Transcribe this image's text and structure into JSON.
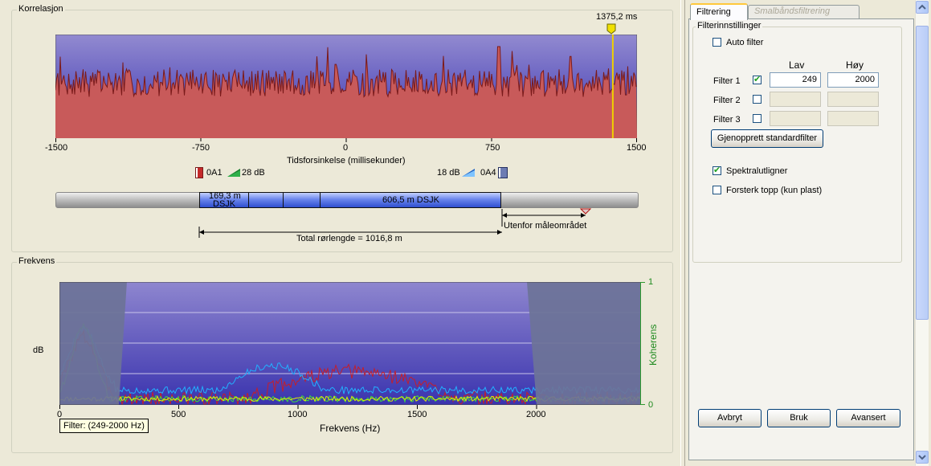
{
  "correlation": {
    "title": "Korrelasjon",
    "marker_label": "1375,2 ms",
    "marker_value_ms": 1375.2,
    "x_ticks": [
      "-1500",
      "-750",
      "0",
      "750",
      "1500"
    ],
    "x_label": "Tidsforsinkelse (millisekunder)",
    "legend": {
      "sensor_a": "0A1",
      "gain_a": "28 dB",
      "gain_b": "18 dB",
      "sensor_b": "0A4"
    },
    "colors": {
      "fill": "#c85a5a",
      "line": "#7a1a1a",
      "bg_top": "#8f86cc",
      "bg_bottom": "#3a34b0",
      "marker": "#f0d000"
    }
  },
  "pipe": {
    "seg1_label_a": "169,3 m",
    "seg1_label_b": "DSJK",
    "seg2_label": "606,5 m DSJK",
    "out_of_range": "Utenfor måleområdet",
    "total_length": "Total rørlengde = 1016,8 m"
  },
  "frequency": {
    "title": "Frekvens",
    "y_left_label": "dB",
    "y_right_label": "Koherens",
    "y_right_ticks": [
      "1",
      "0"
    ],
    "x_ticks": [
      "0",
      "500",
      "1000",
      "1500",
      "2000"
    ],
    "x_label": "Frekvens (Hz)",
    "filter_tooltip": "Filter: (249-2000 Hz)",
    "filter_low_hz": 249,
    "filter_high_hz": 2000,
    "colors": {
      "red": "#c41e2a",
      "blue": "#22b0ff",
      "green": "#3ddc3d",
      "yellow": "#e0f000",
      "masked": "#6d7398"
    }
  },
  "panel": {
    "tabs": [
      "Filtrering",
      "Smalbåndsfiltrering"
    ],
    "group_title": "Filterinnstillinger",
    "auto_filter": {
      "label": "Auto filter",
      "checked": false
    },
    "col_low": "Lav",
    "col_high": "Høy",
    "filters": [
      {
        "label": "Filter 1",
        "checked": true,
        "low": "249",
        "high": "2000"
      },
      {
        "label": "Filter 2",
        "checked": false,
        "low": "",
        "high": ""
      },
      {
        "label": "Filter 3",
        "checked": false,
        "low": "",
        "high": ""
      }
    ],
    "restore_button": "Gjenopprett standardfilter",
    "spectral": {
      "label": "Spektralutligner",
      "checked": true
    },
    "amplify": {
      "label": "Forsterk topp (kun plast)",
      "checked": false
    },
    "buttons": {
      "cancel": "Avbryt",
      "use": "Bruk",
      "advanced": "Avansert"
    }
  }
}
